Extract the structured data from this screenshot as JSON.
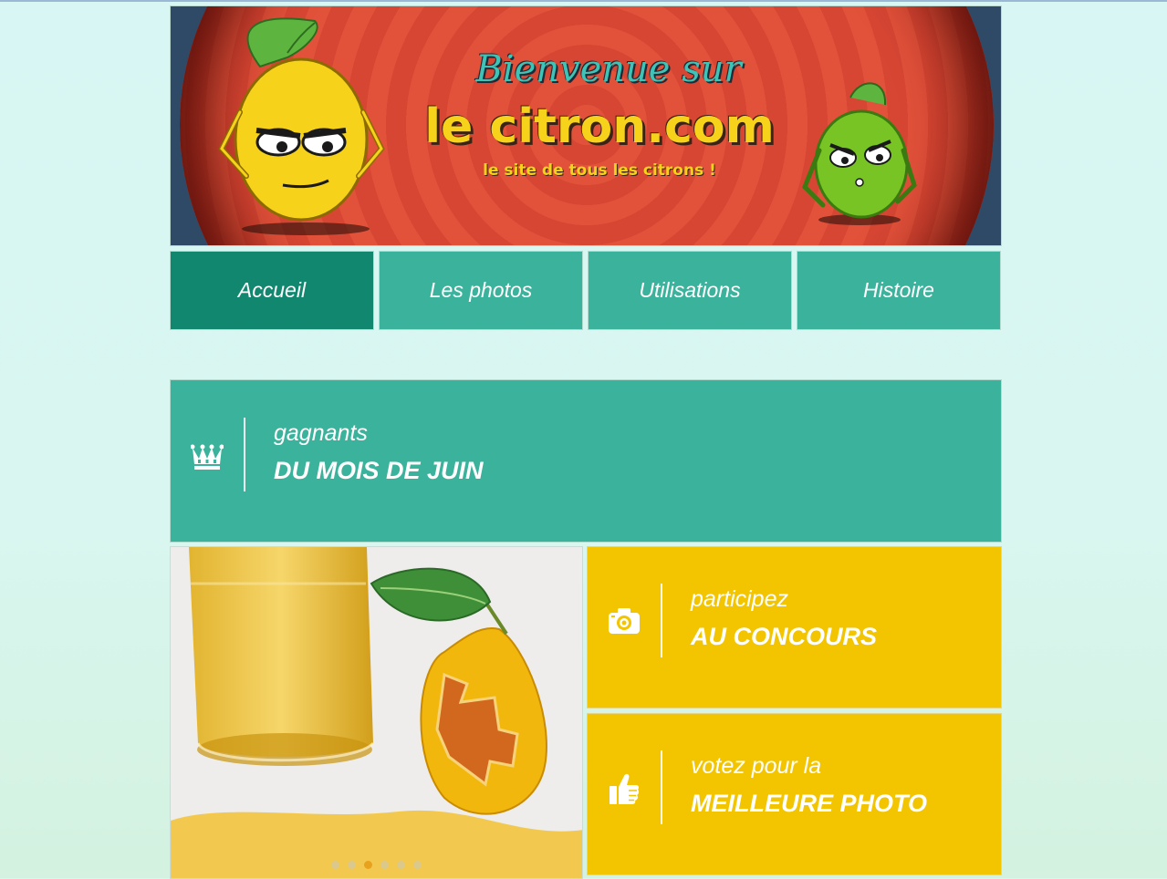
{
  "banner": {
    "title_line1": "Bienvenue sur",
    "title_line2": "le citron.com",
    "subtitle": "le site de  tous les citrons !"
  },
  "nav": {
    "items": [
      {
        "label": "Accueil",
        "active": true
      },
      {
        "label": "Les photos",
        "active": false
      },
      {
        "label": "Utilisations",
        "active": false
      },
      {
        "label": "Histoire",
        "active": false
      }
    ]
  },
  "winners": {
    "icon": "crown-icon",
    "small": "gagnants",
    "big": "DU MOIS DE JUIN"
  },
  "contest": {
    "icon": "camera-icon",
    "small": "participez",
    "big": "AU CONCOURS"
  },
  "vote": {
    "icon": "thumbs-up-icon",
    "small": "votez pour la",
    "big": "MEILLEURE PHOTO"
  },
  "slideshow": {
    "slide_count": 6,
    "active_slide": 3
  },
  "colors": {
    "teal": "#3bb39c",
    "teal_active": "#12876f",
    "yellow": "#f2c500",
    "background": "#d8f7f4"
  }
}
